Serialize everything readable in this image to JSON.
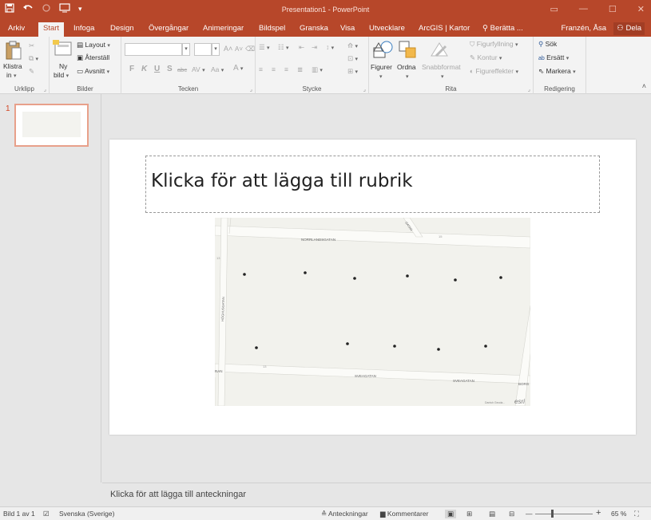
{
  "app": {
    "window_title": "Presentation1 - PowerPoint",
    "user": "Franzén, Åsa",
    "share": "Dela"
  },
  "colors": {
    "accent": "#b7472a",
    "ribbon_bg": "#f3f3f3"
  },
  "tabs": [
    "Arkiv",
    "Start",
    "Infoga",
    "Design",
    "Övergångar",
    "Animeringar",
    "Bildspel",
    "Granska",
    "Visa",
    "Utvecklare",
    "ArcGIS | Kartor",
    "Berätta ..."
  ],
  "ribbon": {
    "clipboard": {
      "paste": "Klistra",
      "paste2": "in",
      "label": "Urklipp"
    },
    "slides": {
      "new": "Ny",
      "new2": "bild",
      "layout": "Layout",
      "reset": "Återställ",
      "section": "Avsnitt",
      "label": "Bilder"
    },
    "font": {
      "label": "Tecken",
      "bold": "F",
      "italic": "K",
      "underline": "U",
      "shadow": "S",
      "strike": "abc",
      "spacing": "AV",
      "case": "Aa",
      "grow": "A",
      "shrink": "A"
    },
    "paragraph": {
      "label": "Stycke"
    },
    "drawing": {
      "shapes": "Figurer",
      "arrange": "Ordna",
      "quickstyles": "Snabbformat",
      "fill": "Figurfyllning",
      "outline": "Kontur",
      "effects": "Figureffekter",
      "label": "Rita"
    },
    "editing": {
      "find": "Sök",
      "replace": "Ersätt",
      "select": "Markera",
      "label": "Redigering"
    }
  },
  "thumbnail": {
    "number": "1"
  },
  "slide": {
    "title_placeholder": "Klicka för att lägga till rubrik"
  },
  "map": {
    "streets": [
      "NORRLANDSGATAN",
      "HÖGHUSGATAN",
      "SVEAGATAN",
      "SVEAGATAN",
      "GATAN",
      "BORG",
      "RAN"
    ],
    "numbers": [
      "15",
      "13",
      "13"
    ],
    "attribution": "Danish Geoda...",
    "logo": "esri"
  },
  "notes": {
    "placeholder": "Klicka för att lägga till anteckningar"
  },
  "status": {
    "slide": "Bild 1 av 1",
    "language": "Svenska (Sverige)",
    "notes": "Anteckningar",
    "comments": "Kommentarer",
    "zoom": "65 %"
  }
}
